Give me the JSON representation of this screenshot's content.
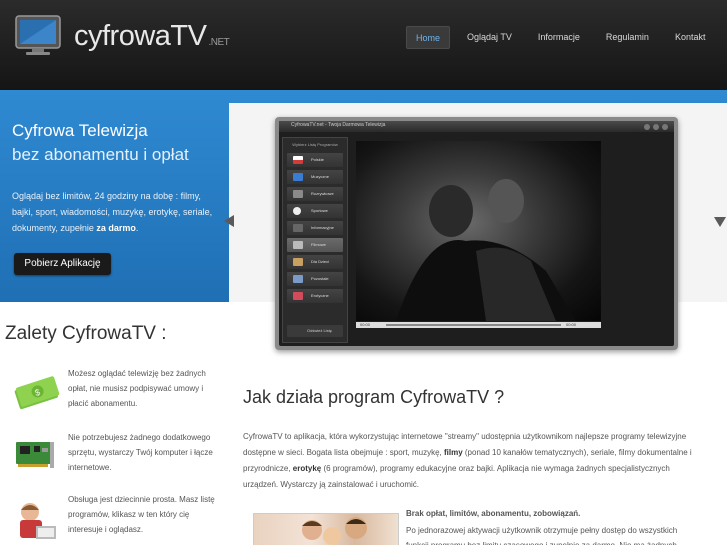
{
  "header": {
    "logo_text": "cyfrowaTV",
    "logo_suffix": ".NET",
    "nav": [
      {
        "label": "Home",
        "active": true
      },
      {
        "label": "Oglądaj TV",
        "active": false
      },
      {
        "label": "Informacje",
        "active": false
      },
      {
        "label": "Regulamin",
        "active": false
      },
      {
        "label": "Kontakt",
        "active": false
      }
    ]
  },
  "hero": {
    "title_line1": "Cyfrowa Telewizja",
    "title_line2": "bez abonamentu i opłat",
    "description": "Oglądaj bez limitów, 24 godziny na dobę : filmy, bajki, sport, wiadomości, muzykę, erotykę, seriale, dokumenty, zupełnie ",
    "description_bold": "za darmo",
    "description_end": ".",
    "download_button": "Pobierz Aplikację"
  },
  "app_screenshot": {
    "window_title": "CyfrowaTV.net - Twoja Darmowa Telewizja",
    "sidebar_header": "Wybierz Listę Programów",
    "channels": [
      {
        "label": "Polskie",
        "color": "#d33a3a"
      },
      {
        "label": "Muzyczne",
        "color": "#3a7bd3"
      },
      {
        "label": "Rozrywkowe",
        "color": "#8a8a8a"
      },
      {
        "label": "Sportowe",
        "color": "#eeeeee"
      },
      {
        "label": "Informacyjne",
        "color": "#4a4a4a"
      },
      {
        "label": "Filmowe",
        "color": "#bbbbbb"
      },
      {
        "label": "Dla Dzieci",
        "color": "#c8a060"
      },
      {
        "label": "Pozostałe",
        "color": "#7a9ac8"
      },
      {
        "label": "Erotyczne",
        "color": "#d34a5a"
      }
    ],
    "selected_channel": "Filmowe",
    "refresh_label": "Odśwież Listę",
    "time_left": "00:00",
    "time_right": "00:00"
  },
  "zalety": {
    "title": "Zalety CyfrowaTV :",
    "items": [
      {
        "icon": "money-icon",
        "text": "Możesz oglądać telewizję bez żadnych opłat, nie musisz podpisywać umowy i płacić abonamentu."
      },
      {
        "icon": "tv-card-icon",
        "text": "Nie potrzebujesz żadnego dodatkowego sprzętu, wystarczy Twój komputer i łącze internetowe."
      },
      {
        "icon": "child-icon",
        "text": "Obsługa jest dziecinnie prosta. Masz listę programów, klikasz w ten który cię interesuje i oglądasz."
      }
    ]
  },
  "jak": {
    "title": "Jak działa program CyfrowaTV ?",
    "desc_part1": "CyfrowaTV to aplikacja, która wykorzystując internetowe \"streamy\" udostępnia użytkownikom najlepsze programy telewizyjne dostępne w sieci. Bogata lista obejmuje : sport, muzykę, ",
    "desc_bold1": "filmy",
    "desc_part2": " (ponad 10 kanałów tematycznych), seriale, filmy dokumentalne i przyrodnicze, ",
    "desc_bold2": "erotykę",
    "desc_part3": " (6 programów), programy edukacyjne oraz bajki. Aplikacja nie wymaga żadnych specjalistycznych urządzeń. Wystarczy ją zainstalować i uruchomić."
  },
  "brak": {
    "title": "Brak opłat, limitów, abonamentu, zobowiązań.",
    "description": "Po jednorazowej aktywacji użytkownik otrzymuje pełny dostęp do wszystkich funkcji programu bez limitu czasowego i zupełnie za darmo. Nie ma żadnych"
  }
}
